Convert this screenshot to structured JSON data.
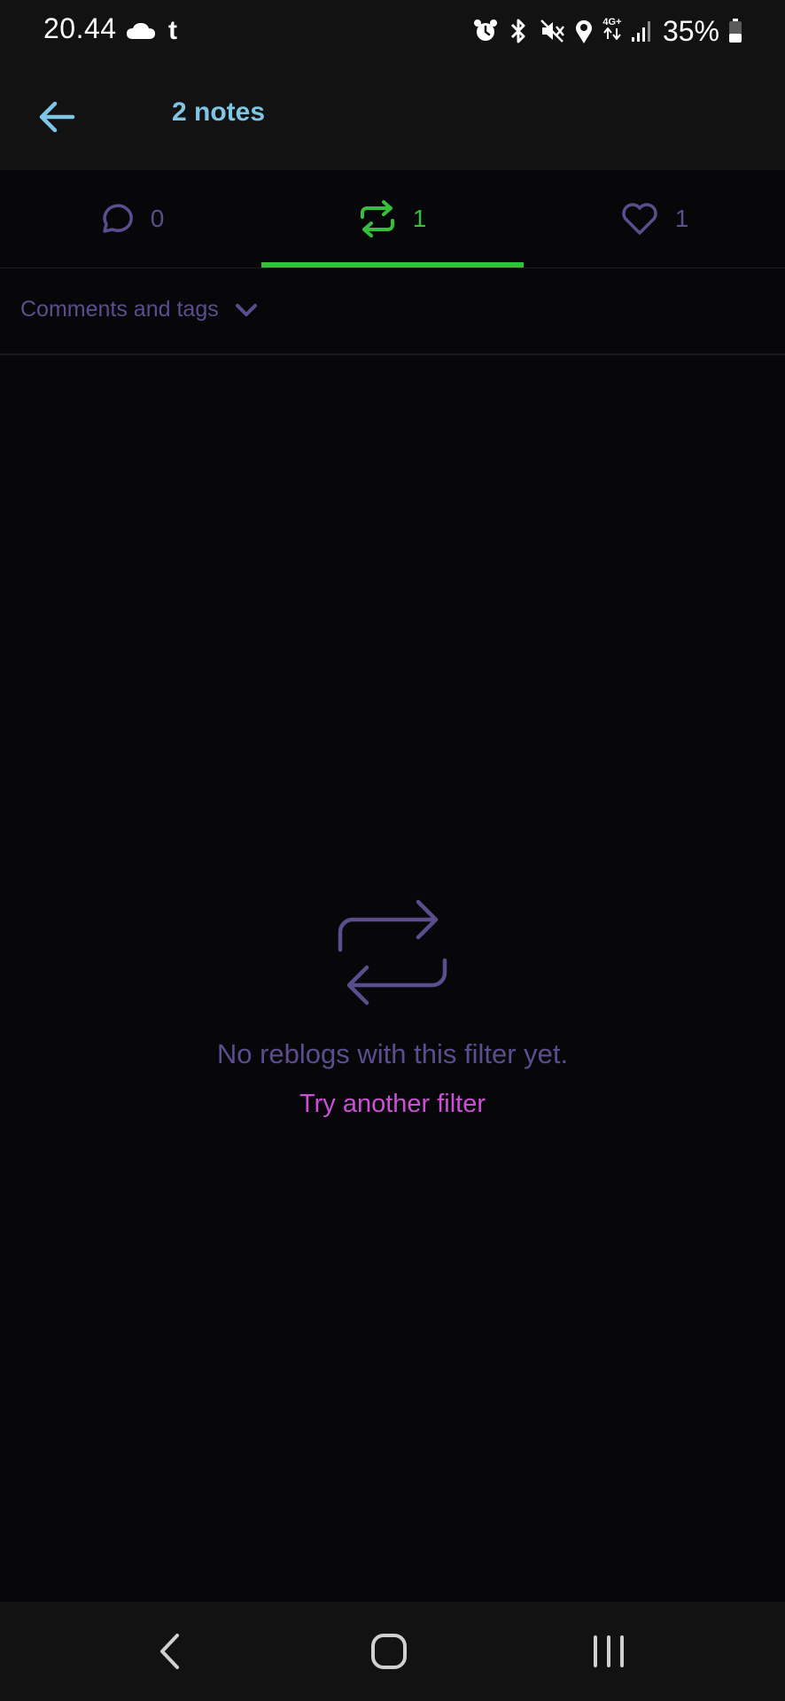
{
  "status_bar": {
    "time": "20.44",
    "app_letter": "t",
    "network_top": "4G+",
    "battery": "35%"
  },
  "header": {
    "title": "2 notes"
  },
  "tabs": [
    {
      "name": "comments",
      "icon": "speech-bubble-icon",
      "count": "0",
      "active": false
    },
    {
      "name": "reblogs",
      "icon": "reblog-icon",
      "count": "1",
      "active": true
    },
    {
      "name": "likes",
      "icon": "heart-icon",
      "count": "1",
      "active": false
    }
  ],
  "filter": {
    "label": "Comments and tags"
  },
  "empty_state": {
    "icon": "reblog-icon",
    "message": "No reblogs with this filter yet.",
    "action_label": "Try another filter"
  },
  "colors": {
    "background": "#070709",
    "header_bg": "#121212",
    "accent_blue": "#7fc5e5",
    "active_green": "#35c03a",
    "muted_purple": "#5b4d8e",
    "action_pink": "#cc4fd6"
  },
  "nav_bar": {
    "back": "back-icon",
    "home": "home-icon",
    "recents": "recents-icon"
  }
}
